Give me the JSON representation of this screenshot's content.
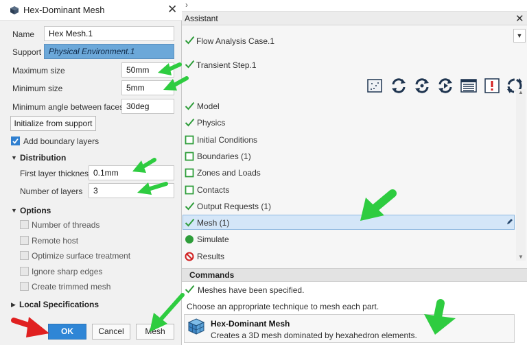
{
  "dialog": {
    "title": "Hex-Dominant Mesh",
    "name_label": "Name",
    "name_value": "Hex Mesh.1",
    "support_label": "Support",
    "support_value": "Physical Environment.1",
    "max_size_label": "Maximum size",
    "max_size_value": "50mm",
    "min_size_label": "Minimum size",
    "min_size_value": "5mm",
    "min_angle_label": "Minimum angle between faces",
    "min_angle_value": "30deg",
    "init_button": "Initialize from support",
    "add_boundary_layers": "Add boundary layers",
    "distribution": {
      "title": "Distribution",
      "first_layer_label": "First layer thickness",
      "first_layer_value": "0.1mm",
      "num_layers_label": "Number of layers",
      "num_layers_value": "3"
    },
    "options": {
      "title": "Options",
      "items": [
        "Number of threads",
        "Remote host",
        "Optimize surface treatment",
        "Ignore sharp edges",
        "Create trimmed mesh"
      ]
    },
    "local_specifications": "Local Specifications",
    "ok_button": "OK",
    "cancel_button": "Cancel",
    "mesh_button": "Mesh"
  },
  "assistant": {
    "chevron": "›",
    "title": "Assistant",
    "case": "Flow Analysis Case.1",
    "step": "Transient Step.1",
    "tree": [
      {
        "label": "Model",
        "status": "done"
      },
      {
        "label": "Physics",
        "status": "done"
      },
      {
        "label": "Initial Conditions",
        "status": "todo"
      },
      {
        "label": "Boundaries (1)",
        "status": "todo"
      },
      {
        "label": "Zones and Loads",
        "status": "todo"
      },
      {
        "label": "Contacts",
        "status": "todo"
      },
      {
        "label": "Output Requests (1)",
        "status": "done"
      },
      {
        "label": "Mesh (1)",
        "status": "done"
      },
      {
        "label": "Simulate",
        "status": "ready"
      },
      {
        "label": "Results",
        "status": "blocked"
      }
    ],
    "commands": {
      "title": "Commands",
      "status": "Meshes have been specified.",
      "hint": "Choose an appropriate technique to mesh each part.",
      "card_title": "Hex-Dominant Mesh",
      "card_desc": "Creates a 3D mesh dominated by hexahedron elements."
    }
  },
  "colors": {
    "accent": "#2f86d6",
    "check_green": "#2e9d3a",
    "arrow_green": "#2ecc40",
    "arrow_red": "#e02020",
    "selected_row": "#d4e6f8"
  }
}
